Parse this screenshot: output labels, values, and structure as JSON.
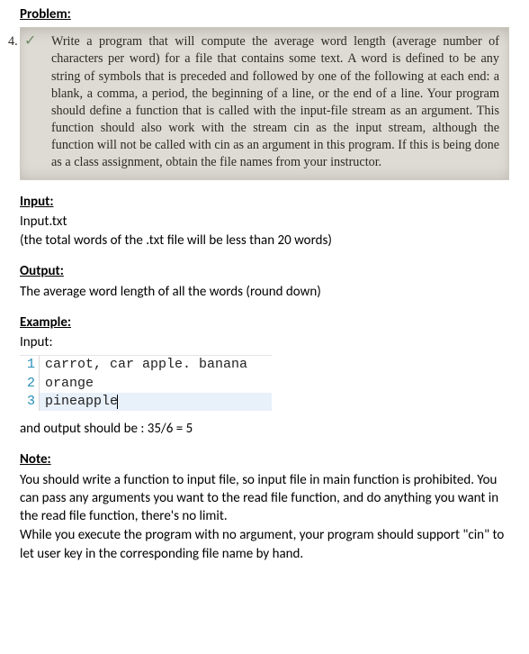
{
  "headings": {
    "problem": "Problem:",
    "input": "Input:",
    "output": "Output:",
    "example": "Example:",
    "note": "Note:"
  },
  "problem": {
    "number": "4.",
    "check": "✓",
    "text": "Write a program that will compute the average word length (average number of characters per word) for a file that contains some text. A word is defined to be any string of symbols that is preceded and followed by one of the following at each end: a blank, a comma, a period, the beginning of a line, or the end of a line. Your program should define a function that is called with the input-file stream as an argument. This function should also work with the stream cin as the input stream, although the function will not be called with cin as an argument in this program. If this is being done as a class assignment, obtain the file names from your instructor."
  },
  "input_section": {
    "filename": "Input.txt",
    "note": "(the total words of the .txt file will be less than 20 words)"
  },
  "output_section": {
    "desc": "The average word length of all the words (round down)"
  },
  "example": {
    "label": "Input:",
    "editor": {
      "lines": [
        {
          "n": "1",
          "t": "carrot, car apple. banana"
        },
        {
          "n": "2",
          "t": "orange"
        },
        {
          "n": "3",
          "t": "pineapple"
        }
      ]
    },
    "output_line": "and output should be : 35/6 = 5"
  },
  "note_section": {
    "p1": "You should write a function to input file, so input file in main function is prohibited. You can pass any arguments you want to the read file function, and do anything you want in the read file function, there's no limit.",
    "p2": "While you execute the program with no argument, your program should support \"cin\" to let user key in the corresponding file name by hand."
  }
}
